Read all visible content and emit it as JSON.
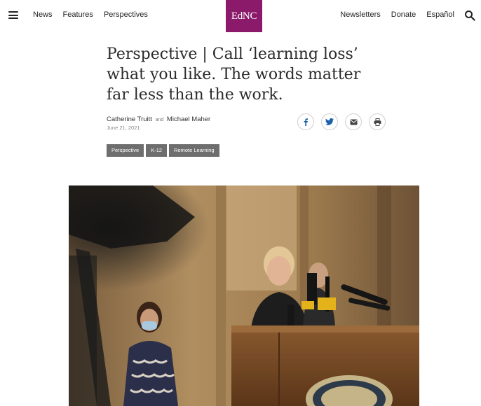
{
  "nav": {
    "left": [
      "News",
      "Features",
      "Perspectives"
    ],
    "right": [
      "Newsletters",
      "Donate",
      "Español"
    ],
    "logo_text": "EdNC",
    "icons": {
      "menu": "hamburger-icon",
      "search": "search-icon"
    }
  },
  "article": {
    "headline": "Perspective | Call ‘learning loss’ what you like. The words matter far less than the work.",
    "author1": "Catherine Truitt",
    "and": "and",
    "author2": "Michael Maher",
    "date": "June 21, 2021",
    "share_icons": [
      "facebook-icon",
      "twitter-icon",
      "email-icon",
      "print-icon"
    ],
    "tags": [
      "Perspective",
      "K-12",
      "Remote Learning"
    ]
  },
  "colors": {
    "brand": "#8b1a6b",
    "tag_bg": "#6e6e6e",
    "share_blue": "#1a5fa8"
  }
}
